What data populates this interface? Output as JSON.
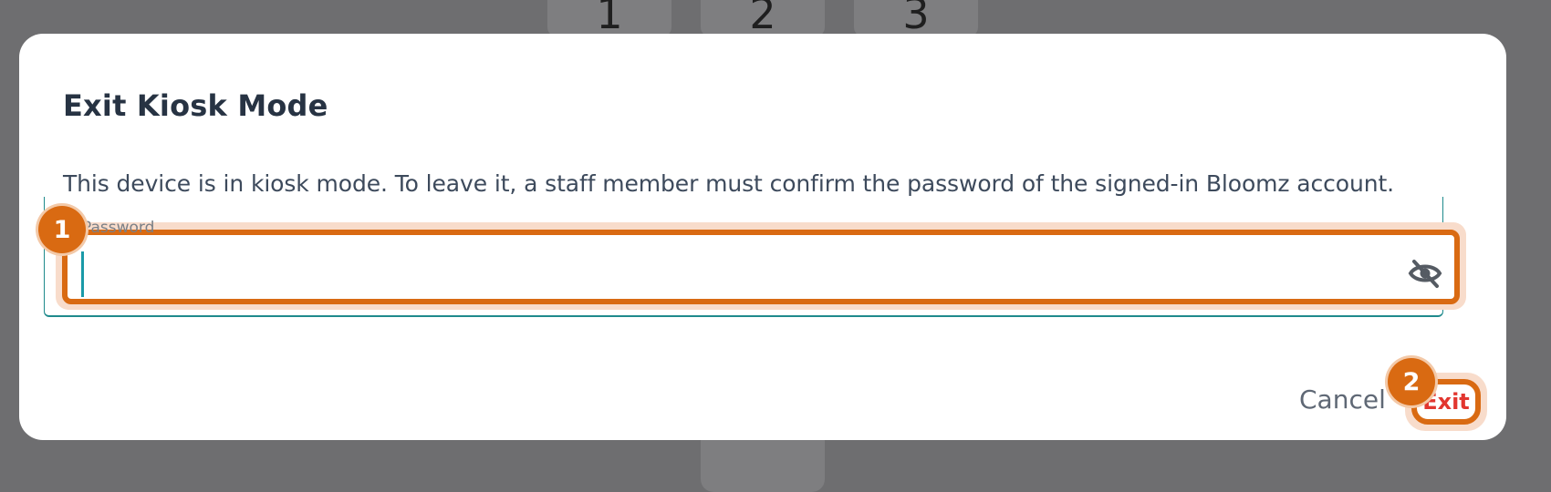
{
  "keypad": {
    "keys": [
      "1",
      "2",
      "3"
    ]
  },
  "dialog": {
    "title": "Exit Kiosk Mode",
    "message": "This device is in kiosk mode. To leave it, a staff member must confirm the password of the signed-in Bloomz account.",
    "password_field": {
      "label": "Password",
      "value": ""
    },
    "cancel_label": "Cancel",
    "exit_label": "Exit"
  },
  "annotations": {
    "badge_1": "1",
    "badge_2": "2"
  },
  "colors": {
    "accent": "#d96a12",
    "danger": "#e2362f",
    "focus": "#1a9aa8",
    "title": "#273343",
    "overlay": "#6e6e70"
  },
  "icons": {
    "password_toggle": "eye-off-icon"
  }
}
